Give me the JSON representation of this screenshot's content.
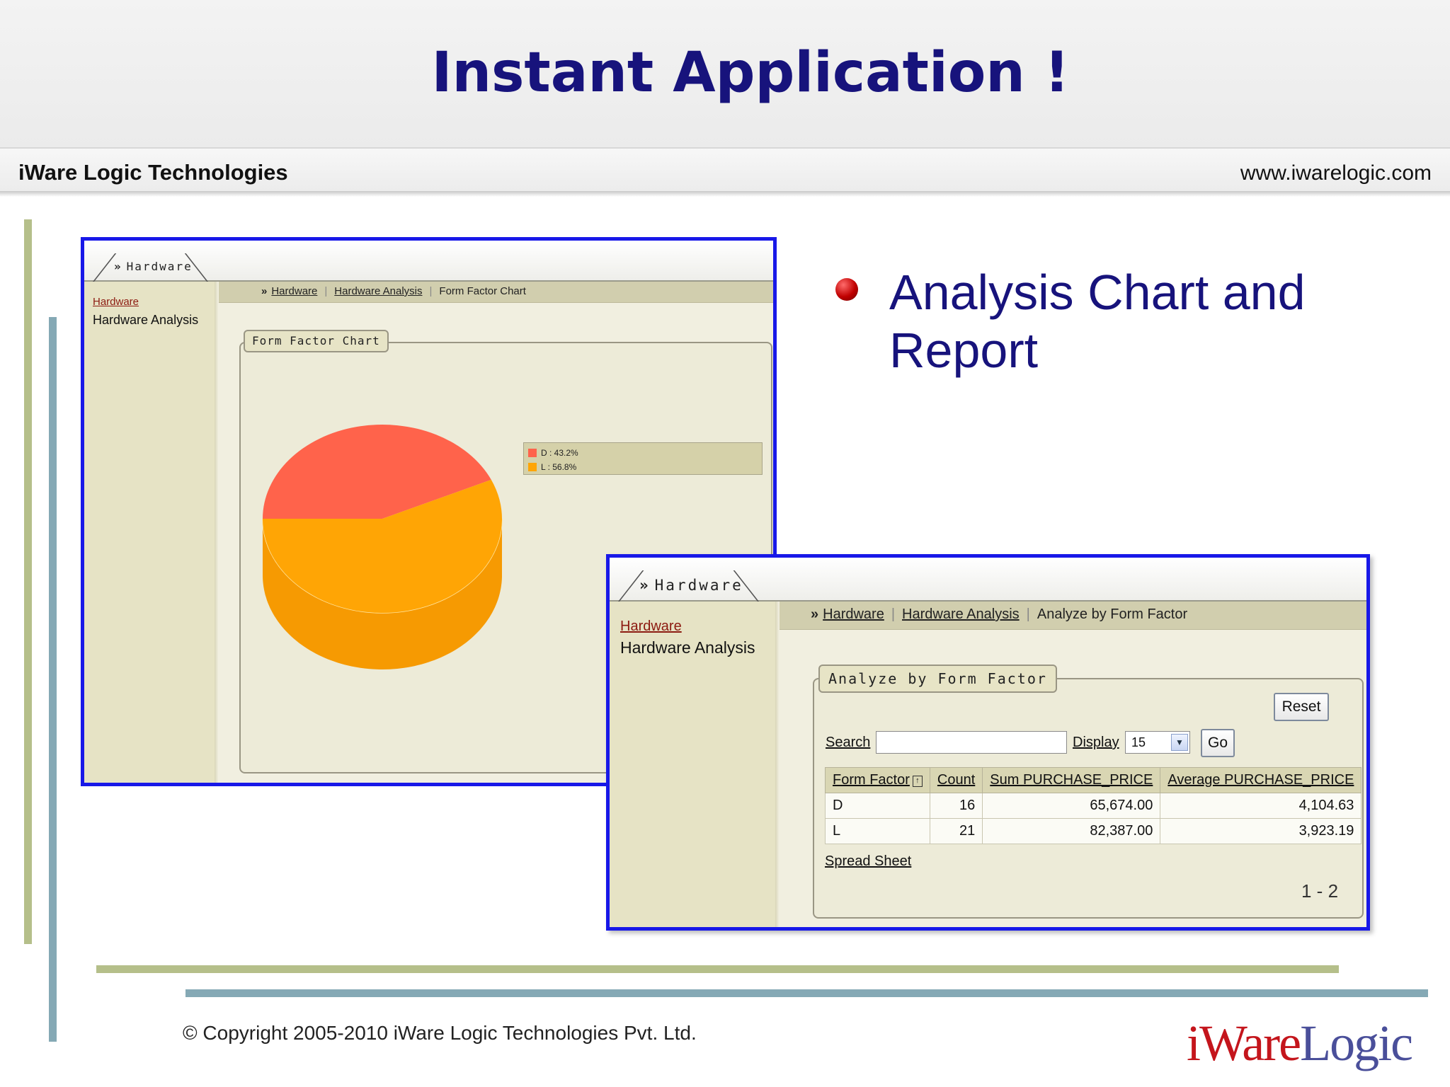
{
  "slide": {
    "title": "Instant Application !",
    "company": "iWare Logic Technologies",
    "website": "www.iwarelogic.com",
    "bullet": "Analysis Chart and Report",
    "copyright": "© Copyright 2005-2010 iWare Logic Technologies Pvt. Ltd.",
    "logo": {
      "i": "i",
      "ware": "Ware",
      "logic": "Logic"
    }
  },
  "chart_window": {
    "tab": "Hardware",
    "breadcrumb": [
      "Hardware",
      "Hardware Analysis",
      "Form Factor Chart"
    ],
    "left_link": "Hardware",
    "left_label": "Hardware Analysis",
    "panel_title": "Form Factor Chart"
  },
  "chart_data": {
    "type": "pie",
    "slices": [
      {
        "label": "D : 43.2%",
        "value": 43.2,
        "color": "#ff634b",
        "side_color": "#e04a36"
      },
      {
        "label": "L : 56.8%",
        "value": 56.8,
        "color": "#ffa505",
        "side_color": "#f69a02"
      }
    ]
  },
  "report_window": {
    "tab": "Hardware",
    "breadcrumb": [
      "Hardware",
      "Hardware Analysis",
      "Analyze by Form Factor"
    ],
    "left_link": "Hardware",
    "left_label": "Hardware Analysis",
    "panel_title": "Analyze by Form Factor",
    "reset_label": "Reset",
    "search_label": "Search",
    "search_value": "",
    "display_label": "Display",
    "display_value": "15",
    "go_label": "Go",
    "columns": [
      "Form Factor",
      "Count",
      "Sum PURCHASE_PRICE",
      "Average PURCHASE_PRICE"
    ],
    "rows": [
      [
        "D",
        "16",
        "65,674.00",
        "4,104.63"
      ],
      [
        "L",
        "21",
        "82,387.00",
        "3,923.19"
      ]
    ],
    "spreadsheet_label": "Spread Sheet",
    "pagination": "1 - 2"
  },
  "colors": {
    "title": "#17137c",
    "window_border": "#1818e8",
    "link_red": "#8c1a10"
  }
}
